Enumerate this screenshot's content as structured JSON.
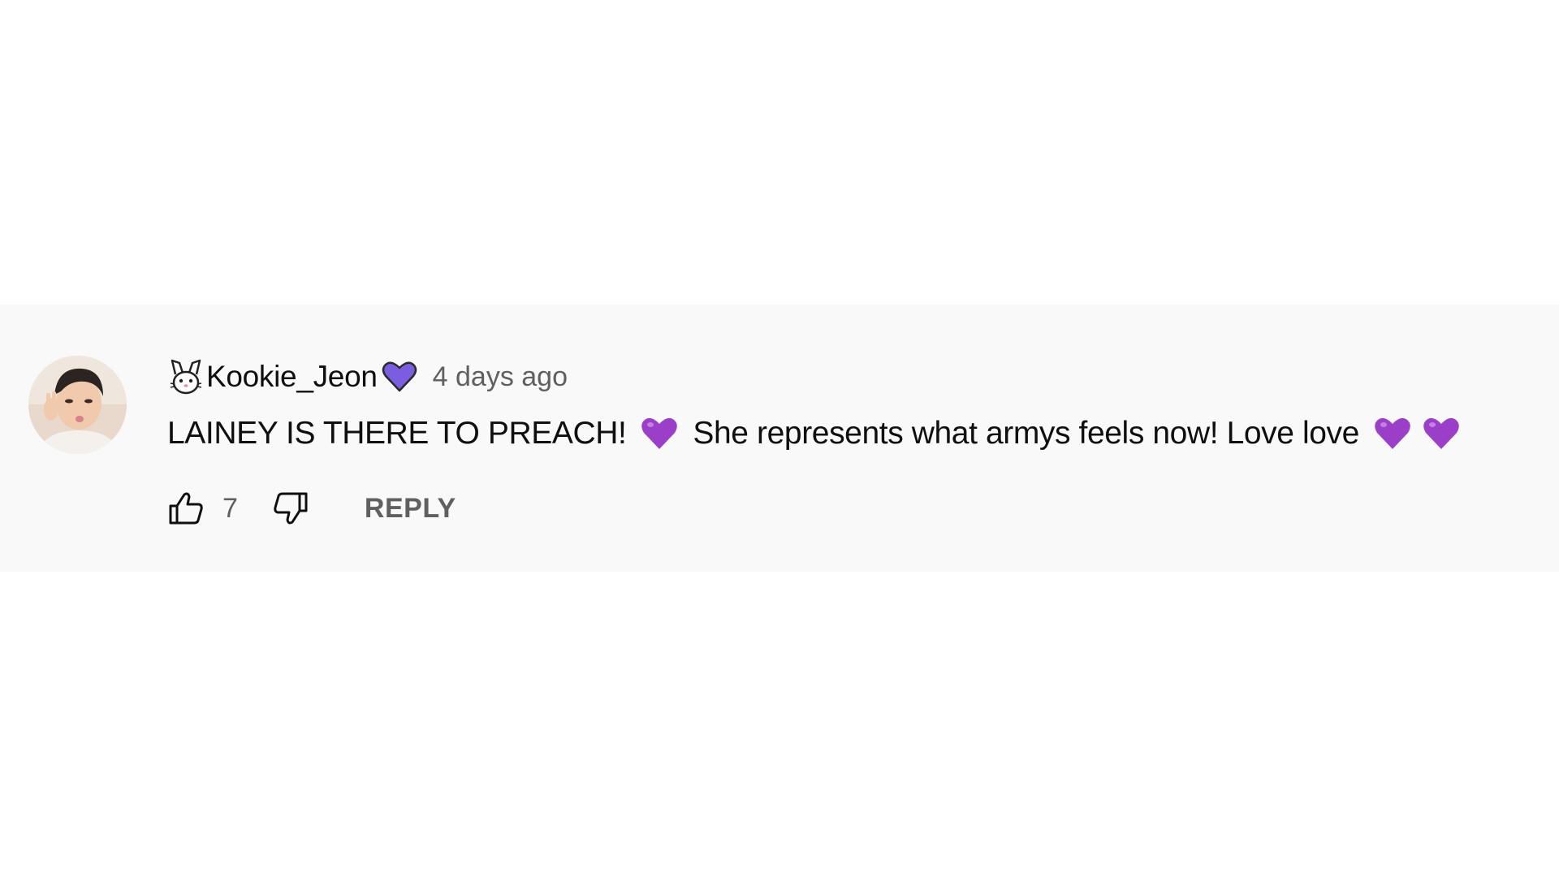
{
  "comment": {
    "author": "Kookie_Jeon",
    "author_prefix_emoji": "rabbit-icon",
    "author_suffix_emoji": "purple-heart-icon",
    "timestamp": "4 days ago",
    "text_part_1": "LAINEY IS THERE TO PREACH!",
    "text_part_2": "She represents what armys feels now! Love love",
    "like_count": "7",
    "reply_label": "REPLY"
  },
  "colors": {
    "band_background": "#f9f9f9",
    "text_primary": "#0f0f0f",
    "text_secondary": "#606060",
    "heart_purple": "#8e44ad"
  }
}
